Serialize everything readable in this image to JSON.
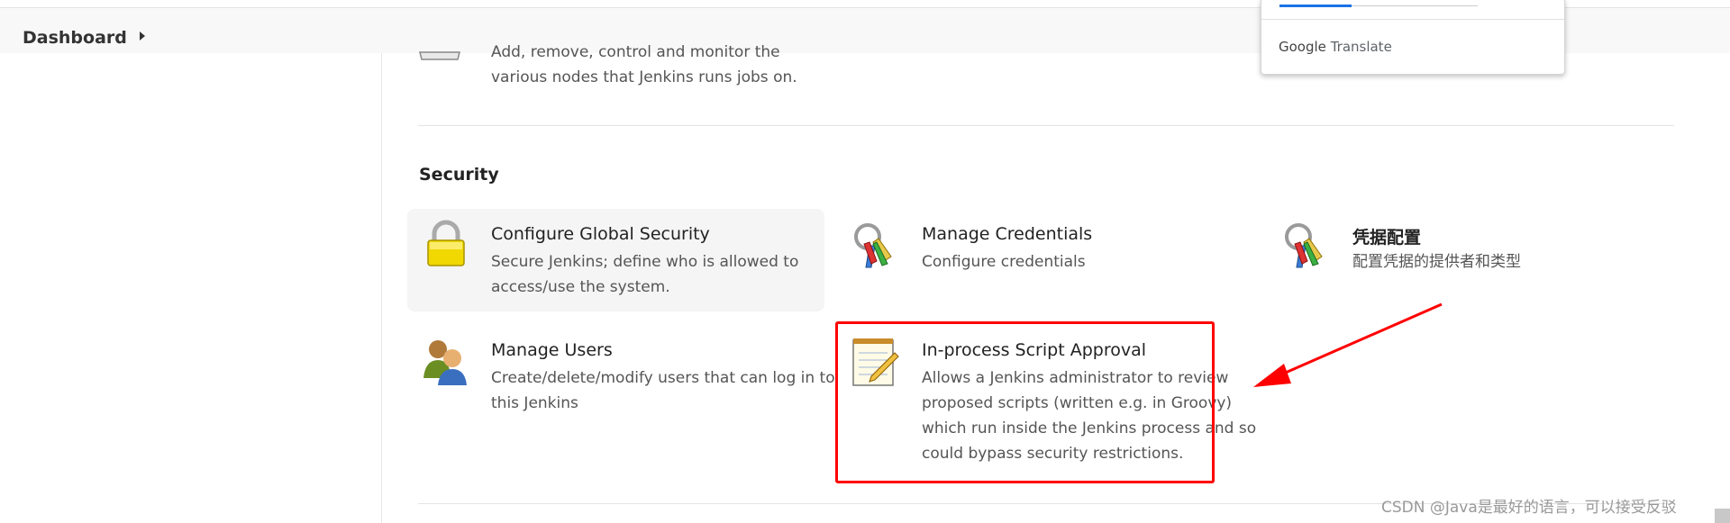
{
  "breadcrumb": {
    "label": "Dashboard"
  },
  "nodes_item": {
    "desc_line1": "Add, remove, control and monitor the",
    "desc_line2": "various nodes that Jenkins runs jobs on."
  },
  "security": {
    "heading": "Security",
    "items": [
      {
        "title": "Configure Global Security",
        "desc_line1": "Secure Jenkins; define who is allowed to",
        "desc_line2": "access/use the system.",
        "icon": "lock-icon"
      },
      {
        "title": "Manage Credentials",
        "desc_line1": "Configure credentials",
        "icon": "keys-icon"
      },
      {
        "title": "凭据配置",
        "desc_line1": "配置凭据的提供者和类型",
        "icon": "keys-icon"
      },
      {
        "title": "Manage Users",
        "desc_line1": "Create/delete/modify users that can log in to",
        "desc_line2": "this Jenkins",
        "icon": "users-icon"
      },
      {
        "title": "In-process Script Approval",
        "desc_line1": "Allows a Jenkins administrator to review",
        "desc_line2": "proposed scripts (written e.g. in Groovy)",
        "desc_line3": "which run inside the Jenkins process and so",
        "desc_line4": "could bypass security restrictions.",
        "icon": "notepad-icon"
      }
    ]
  },
  "translate_popup": {
    "brand_google": "Google",
    "brand_translate": "Translate"
  },
  "watermark": "CSDN @Java是最好的语言，可以接受反驳",
  "colors": {
    "highlight": "#ff0000",
    "arrow": "#ff0000",
    "tab_accent": "#1a73e8"
  }
}
